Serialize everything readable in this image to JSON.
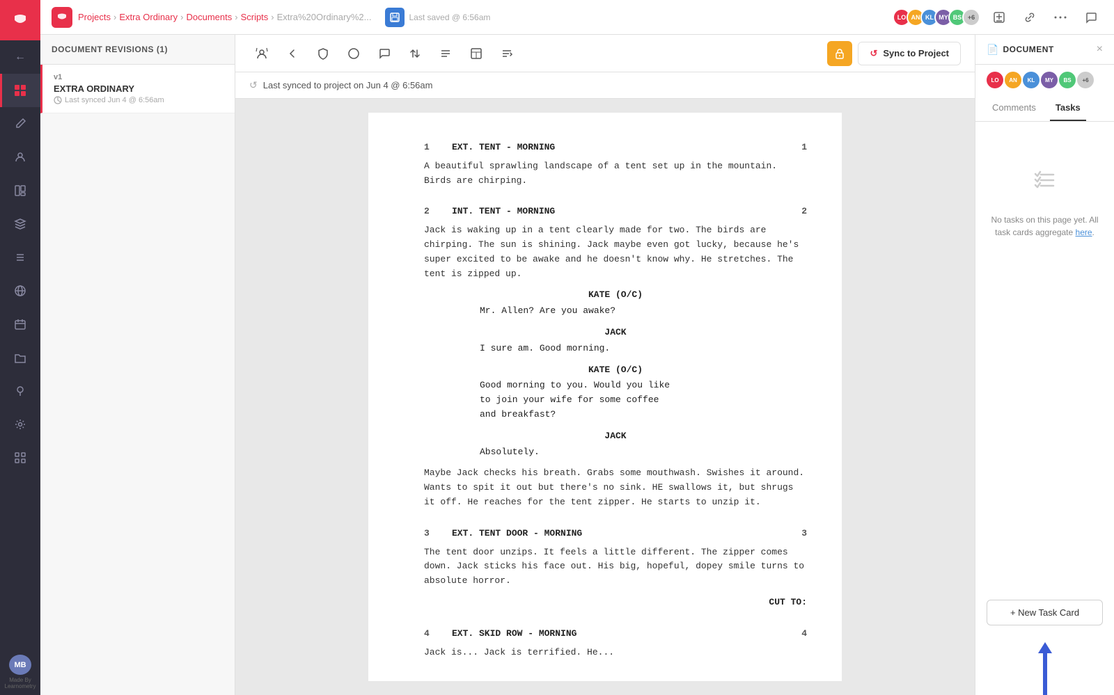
{
  "app": {
    "logo_alt": "Celtx",
    "brand_color": "#e8304a"
  },
  "topbar": {
    "breadcrumbs": [
      {
        "label": "Projects",
        "href": "#"
      },
      {
        "label": "Extra Ordinary",
        "href": "#"
      },
      {
        "label": "Documents",
        "href": "#"
      },
      {
        "label": "Scripts",
        "href": "#"
      },
      {
        "label": "Extra%20Ordinary%2...",
        "href": "#"
      }
    ],
    "save_icon_color": "#3a7bd5",
    "last_saved": "Last saved @ 6:56am",
    "avatars": [
      {
        "initials": "LO",
        "color": "#e8304a"
      },
      {
        "initials": "AN",
        "color": "#f5a623"
      },
      {
        "initials": "KL",
        "color": "#4a90d9"
      },
      {
        "initials": "MY",
        "color": "#7b5ea7"
      },
      {
        "initials": "BS",
        "color": "#50c878"
      },
      {
        "initials": "+6",
        "color": "#ccc",
        "text_color": "#555"
      }
    ]
  },
  "revisions": {
    "header": "DOCUMENT REVISIONS (1)",
    "items": [
      {
        "version": "v1",
        "title": "EXTRA ORDINARY",
        "meta": "Last synced Jun 4 @ 6:56am"
      }
    ]
  },
  "toolbar": {
    "buttons": [
      {
        "name": "characters-icon",
        "symbol": "🎭"
      },
      {
        "name": "revision-icon",
        "symbol": "◀"
      },
      {
        "name": "shield-icon",
        "symbol": "🛡"
      },
      {
        "name": "circle-icon",
        "symbol": "○"
      },
      {
        "name": "comment-icon",
        "symbol": "💬"
      },
      {
        "name": "arrows-icon",
        "symbol": "⇄"
      },
      {
        "name": "lines-icon",
        "symbol": "≡"
      },
      {
        "name": "panel-icon",
        "symbol": "▣"
      },
      {
        "name": "sort-icon",
        "symbol": "⇅"
      }
    ],
    "lock_symbol": "🔒",
    "sync_label": "Sync to Project",
    "sync_icon": "↺"
  },
  "sync_banner": {
    "text": "Last synced to project on Jun 4 @ 6:56am",
    "icon": "↺"
  },
  "script": {
    "scenes": [
      {
        "number": 1,
        "heading": "EXT. TENT - MORNING",
        "action": "A beautiful sprawling landscape of a tent set up in the mountain. Birds are chirping.",
        "dialogues": []
      },
      {
        "number": 2,
        "heading": "INT. TENT - MORNING",
        "action": "Jack is waking up in a tent clearly made for two. The birds are chirping. The sun is shining. Jack maybe even got lucky, because he's super excited to be awake and he doesn't know why. He stretches. The tent is zipped up.",
        "dialogues": [
          {
            "character": "KATE (O/C)",
            "lines": [
              "Mr. Allen? Are you awake?"
            ]
          },
          {
            "character": "JACK",
            "lines": [
              "I sure am. Good morning."
            ]
          },
          {
            "character": "KATE (O/C)",
            "lines": [
              "Good morning to you. Would you like",
              "to join your wife for some coffee",
              "and breakfast?"
            ]
          },
          {
            "character": "JACK",
            "lines": [
              "Absolutely."
            ]
          }
        ],
        "post_action": "Maybe Jack checks his breath. Grabs some mouthwash. Swishes it around. Wants to spit it out but there's no sink. HE swallows it, but shrugs it off. He reaches for the tent zipper. He starts to unzip it."
      },
      {
        "number": 3,
        "heading": "EXT. TENT DOOR - MORNING",
        "action": "The tent door unzips. It feels a little different. The zipper comes down. Jack sticks his face out. His big, hopeful, dopey smile turns to absolute horror.",
        "cut_to": "CUT TO:",
        "dialogues": []
      },
      {
        "number": 4,
        "heading": "EXT. SKID ROW - MORNING",
        "action": "Jack is... Jack is terrified. He...",
        "dialogues": []
      }
    ]
  },
  "right_panel": {
    "title": "DOCUMENT",
    "doc_icon": "📄",
    "close_icon": "×",
    "tabs": [
      {
        "label": "Comments",
        "active": false
      },
      {
        "label": "Tasks",
        "active": true
      }
    ],
    "avatars": [
      {
        "initials": "LO",
        "color": "#e8304a"
      },
      {
        "initials": "AN",
        "color": "#f5a623"
      },
      {
        "initials": "KL",
        "color": "#4a90d9"
      },
      {
        "initials": "MY",
        "color": "#7b5ea7"
      },
      {
        "initials": "BS",
        "color": "#50c878"
      },
      {
        "initials": "+6",
        "color": "#ccc"
      }
    ],
    "tasks_empty_text": "No tasks on this page yet. All task cards aggregate ",
    "tasks_link_text": "here",
    "new_task_label": "+ New Task Card"
  },
  "left_nav": {
    "items": [
      {
        "name": "back-icon",
        "symbol": "←",
        "active": false
      },
      {
        "name": "home-icon",
        "symbol": "⌂",
        "active": true,
        "color": "#e8304a"
      },
      {
        "name": "edit-icon",
        "symbol": "✏",
        "active": false
      },
      {
        "name": "person-icon",
        "symbol": "👤",
        "active": false
      },
      {
        "name": "board-icon",
        "symbol": "⊞",
        "active": false
      },
      {
        "name": "layers-icon",
        "symbol": "≡",
        "active": false
      },
      {
        "name": "list-icon",
        "symbol": "☰",
        "active": false
      },
      {
        "name": "globe-icon",
        "symbol": "◉",
        "active": false
      },
      {
        "name": "calendar-icon",
        "symbol": "📅",
        "active": false
      },
      {
        "name": "folder-icon",
        "symbol": "📁",
        "active": false
      },
      {
        "name": "pin-icon",
        "symbol": "📌",
        "active": false
      },
      {
        "name": "sliders-icon",
        "symbol": "⚙",
        "active": false
      },
      {
        "name": "grid-icon",
        "symbol": "⊞",
        "active": false
      }
    ],
    "bottom_avatar": {
      "initials": "MB",
      "color": "#6b7bb8"
    },
    "made_by": "Made By\nLearnometry"
  }
}
